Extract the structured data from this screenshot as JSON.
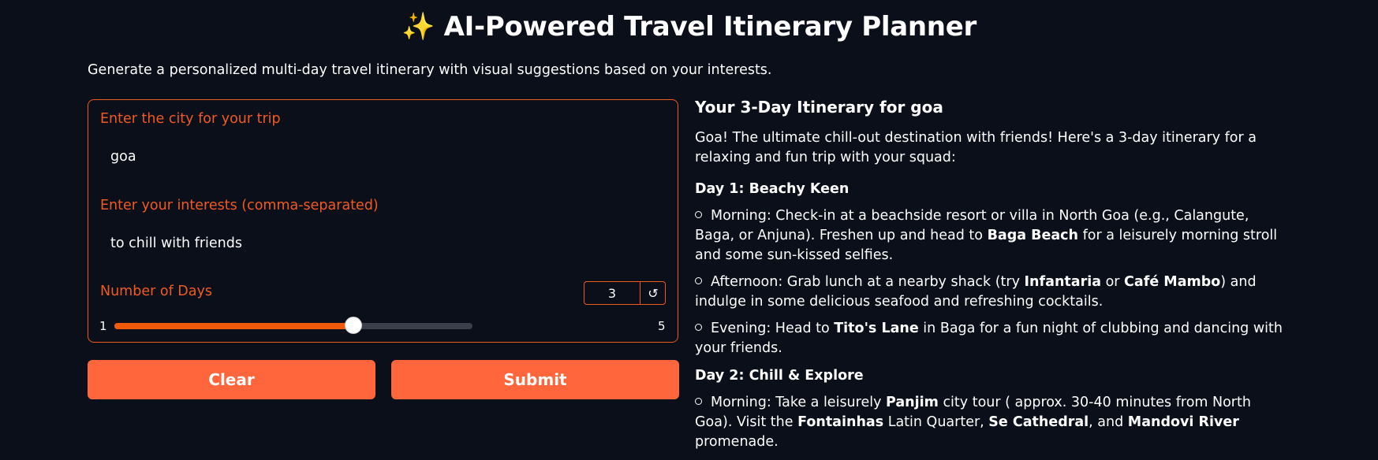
{
  "page": {
    "title_icon": "✨",
    "title": "AI-Powered Travel Itinerary Planner",
    "subtitle": "Generate a personalized multi-day travel itinerary with visual suggestions based on your interests."
  },
  "form": {
    "city_label": "Enter the city for your trip",
    "city_value": "goa",
    "interests_label": "Enter your interests (comma-separated)",
    "interests_value": "to chill with friends",
    "days_label": "Number of Days",
    "days_value": "3",
    "reset_icon": "↺",
    "slider": {
      "min": 1,
      "max": 5,
      "value": 3,
      "min_label": "1",
      "max_label": "5"
    },
    "clear_label": "Clear",
    "submit_label": "Submit"
  },
  "result": {
    "heading": "Your 3-Day Itinerary for goa",
    "intro": "Goa! The ultimate chill-out destination with friends! Here's a 3-day itinerary for a relaxing and fun trip with your squad:",
    "days": [
      {
        "title": "Day 1: Beachy Keen",
        "items": [
          [
            {
              "t": "Morning: Check-in at a beachside resort or villa in North Goa (e.g., Calangute, Baga, or Anjuna). Freshen up and head to "
            },
            {
              "t": "Baga Beach",
              "b": true
            },
            {
              "t": " for a leisurely morning stroll and some sun-kissed selfies."
            }
          ],
          [
            {
              "t": "Afternoon: Grab lunch at a nearby shack (try "
            },
            {
              "t": "Infantaria",
              "b": true
            },
            {
              "t": " or "
            },
            {
              "t": "Café Mambo",
              "b": true
            },
            {
              "t": ") and indulge in some delicious seafood and refreshing cocktails."
            }
          ],
          [
            {
              "t": "Evening: Head to "
            },
            {
              "t": "Tito's Lane",
              "b": true
            },
            {
              "t": " in Baga for a fun night of clubbing and dancing with your friends."
            }
          ]
        ]
      },
      {
        "title": "Day 2: Chill & Explore",
        "items": [
          [
            {
              "t": "Morning: Take a leisurely "
            },
            {
              "t": "Panjim",
              "b": true
            },
            {
              "t": " city tour ( approx. 30-40 minutes from North Goa). Visit the "
            },
            {
              "t": "Fontainhas",
              "b": true
            },
            {
              "t": " Latin Quarter, "
            },
            {
              "t": "Se Cathedral",
              "b": true
            },
            {
              "t": ", and "
            },
            {
              "t": "Mandovi River",
              "b": true
            },
            {
              "t": " promenade."
            }
          ]
        ]
      }
    ]
  },
  "colors": {
    "background": "#0b0f19",
    "accent": "#f05a22",
    "button": "#ff663c",
    "text": "#ffffff"
  }
}
